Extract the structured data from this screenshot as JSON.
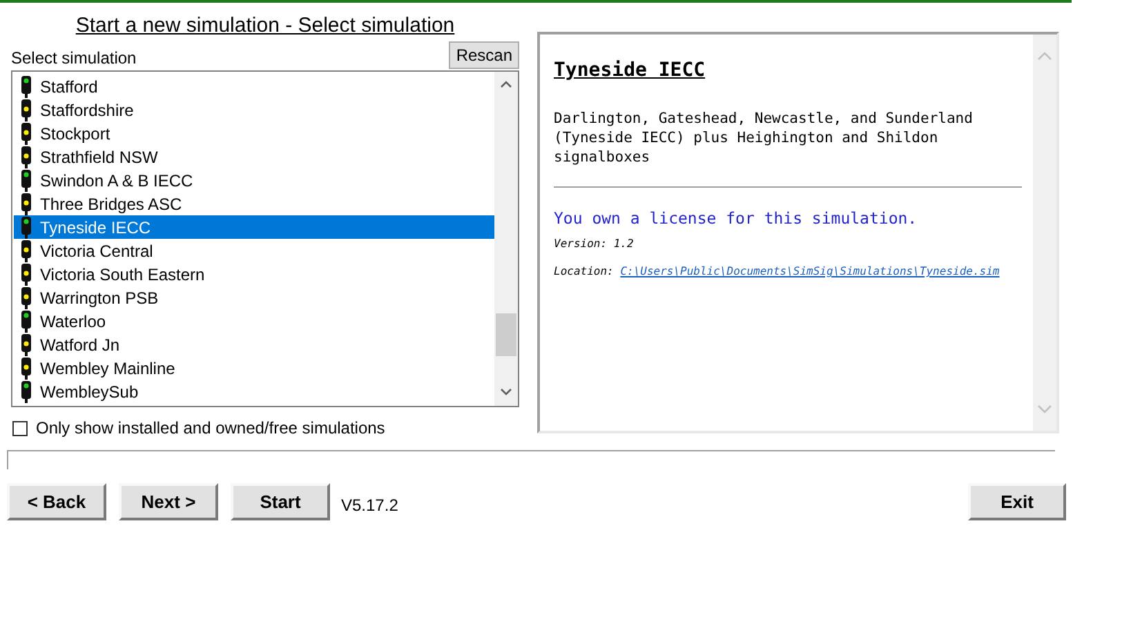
{
  "title": "Start a new simulation - Select simulation",
  "list_label": "Select simulation",
  "rescan_button": "Rescan",
  "simulations": [
    {
      "name": "Stafford",
      "color": "#22cc22",
      "selected": false
    },
    {
      "name": "Staffordshire",
      "color": "#ffee00",
      "selected": false
    },
    {
      "name": "Stockport",
      "color": "#ffee00",
      "selected": false
    },
    {
      "name": "Strathfield NSW",
      "color": "#ffee00",
      "selected": false
    },
    {
      "name": "Swindon A & B IECC",
      "color": "#22cc22",
      "selected": false
    },
    {
      "name": "Three Bridges ASC",
      "color": "#ffee00",
      "selected": false
    },
    {
      "name": "Tyneside IECC",
      "color": "#22cc22",
      "selected": true
    },
    {
      "name": "Victoria Central",
      "color": "#ffee00",
      "selected": false
    },
    {
      "name": "Victoria South Eastern",
      "color": "#ffee00",
      "selected": false
    },
    {
      "name": "Warrington PSB",
      "color": "#ffee00",
      "selected": false
    },
    {
      "name": "Waterloo",
      "color": "#22cc22",
      "selected": false
    },
    {
      "name": "Watford Jn",
      "color": "#ffee00",
      "selected": false
    },
    {
      "name": "Wembley Mainline",
      "color": "#ffee00",
      "selected": false
    },
    {
      "name": "WembleySub",
      "color": "#22cc22",
      "selected": false
    }
  ],
  "filter": {
    "label": "Only show installed and owned/free simulations",
    "checked": false
  },
  "details": {
    "heading": "Tyneside IECC",
    "description": "Darlington, Gateshead, Newcastle, and Sunderland (Tyneside IECC) plus Heighington and Shildon signalboxes",
    "license": "You own a license for this simulation.",
    "version_label": "Version:",
    "version": "1.2",
    "location_label": "Location:",
    "location": "C:\\Users\\Public\\Documents\\SimSig\\Simulations\\Tyneside.sim"
  },
  "buttons": [
    "< Back",
    "Next >",
    "Start"
  ],
  "progress": {
    "level": 0
  },
  "version": "V5.17.2",
  "exit_button": "Exit"
}
